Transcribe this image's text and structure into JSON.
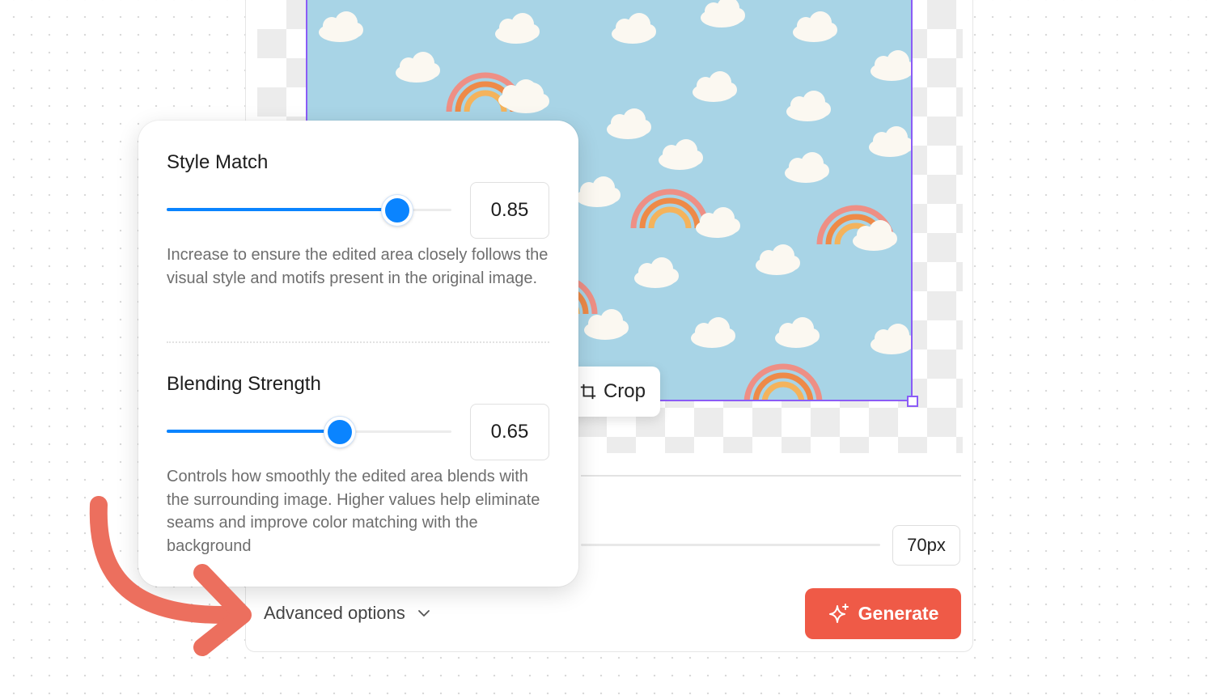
{
  "canvas": {
    "crop_label": "Crop"
  },
  "size_control": {
    "value": "70px"
  },
  "footer": {
    "advanced_options_label": "Advanced options",
    "generate_label": "Generate"
  },
  "settings": {
    "style_match": {
      "title": "Style Match",
      "value": "0.85",
      "fraction": 0.8,
      "description": "Increase to ensure the edited area closely follows the visual style and motifs present in the original image."
    },
    "blending_strength": {
      "title": "Blending Strength",
      "value": "0.65",
      "fraction": 0.6,
      "description": "Controls how smoothly the edited area blends with the surrounding image. Higher values help eliminate seams and improve color matching with the background"
    }
  },
  "colors": {
    "accent_blue": "#0a84ff",
    "generate_red": "#ef5a47",
    "selection_purple": "#8b5cf6",
    "sky_blue": "#a8d4e6",
    "arrow_coral": "#ec6f5e"
  },
  "icons": {
    "crop": "crop-icon",
    "chevron": "chevron-down-icon",
    "generate": "sparkle-icon"
  }
}
